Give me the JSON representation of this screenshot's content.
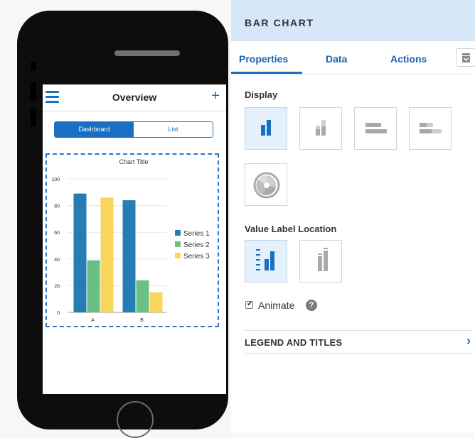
{
  "phone": {
    "app_title": "Overview",
    "segments": [
      "Dashboard",
      "List"
    ],
    "active_segment": "Dashboard"
  },
  "chart_data": {
    "type": "bar",
    "title": "Chart Title",
    "categories": [
      "A",
      "B"
    ],
    "series": [
      {
        "name": "Series 1",
        "values": [
          89,
          84
        ],
        "color": "#267db3"
      },
      {
        "name": "Series 2",
        "values": [
          39,
          24
        ],
        "color": "#68c182"
      },
      {
        "name": "Series 3",
        "values": [
          86,
          15
        ],
        "color": "#fad55c"
      }
    ],
    "y_ticks": [
      0,
      20,
      40,
      60,
      80,
      100
    ],
    "ylim": [
      0,
      100
    ],
    "grid": true,
    "legend_position": "right"
  },
  "panel": {
    "title": "BAR CHART",
    "tabs": [
      "Properties",
      "Data",
      "Actions"
    ],
    "active_tab": "Properties",
    "display_label": "Display",
    "display_options": [
      "vertical-bar",
      "vertical-stacked-bar",
      "horizontal-bar",
      "horizontal-stacked-bar",
      "polar-bar"
    ],
    "selected_display": "vertical-bar",
    "value_label_location_label": "Value Label Location",
    "value_label_options": [
      "outside-labels",
      "inside-labels"
    ],
    "selected_value_label": "outside-labels",
    "animate_label": "Animate",
    "animate_checked": true,
    "legend_section": "LEGEND AND TITLES"
  },
  "colors": {
    "accent": "#1a6fc4",
    "header_bg": "#d6e7f7",
    "selected_bg": "#e4f0fb"
  }
}
